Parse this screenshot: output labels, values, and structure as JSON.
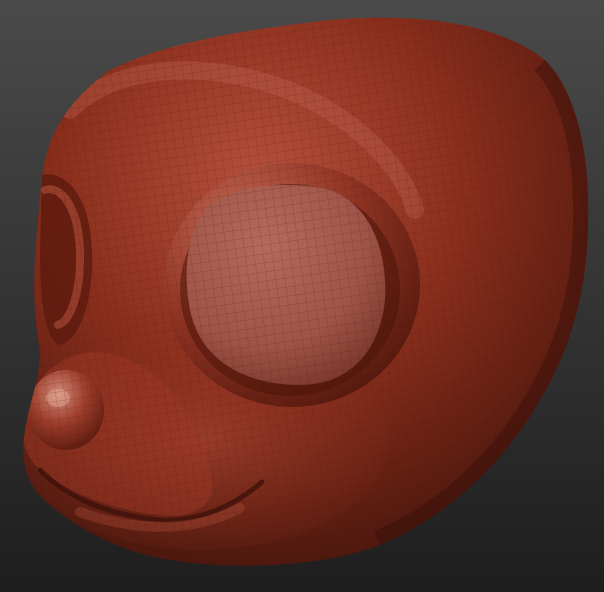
{
  "viewport": {
    "background_top": "#4a4a4a",
    "background_bottom": "#1e1e1e"
  },
  "model": {
    "subject": "stylized-animal-head-sculpt",
    "material_base": "#8a2e1c",
    "material_shadow": "#3d120a",
    "material_highlight": "#c87a66",
    "eye_socket_fill": "#9e5448",
    "wireframe_color": "#4e160c",
    "wireframe_visible": true
  }
}
